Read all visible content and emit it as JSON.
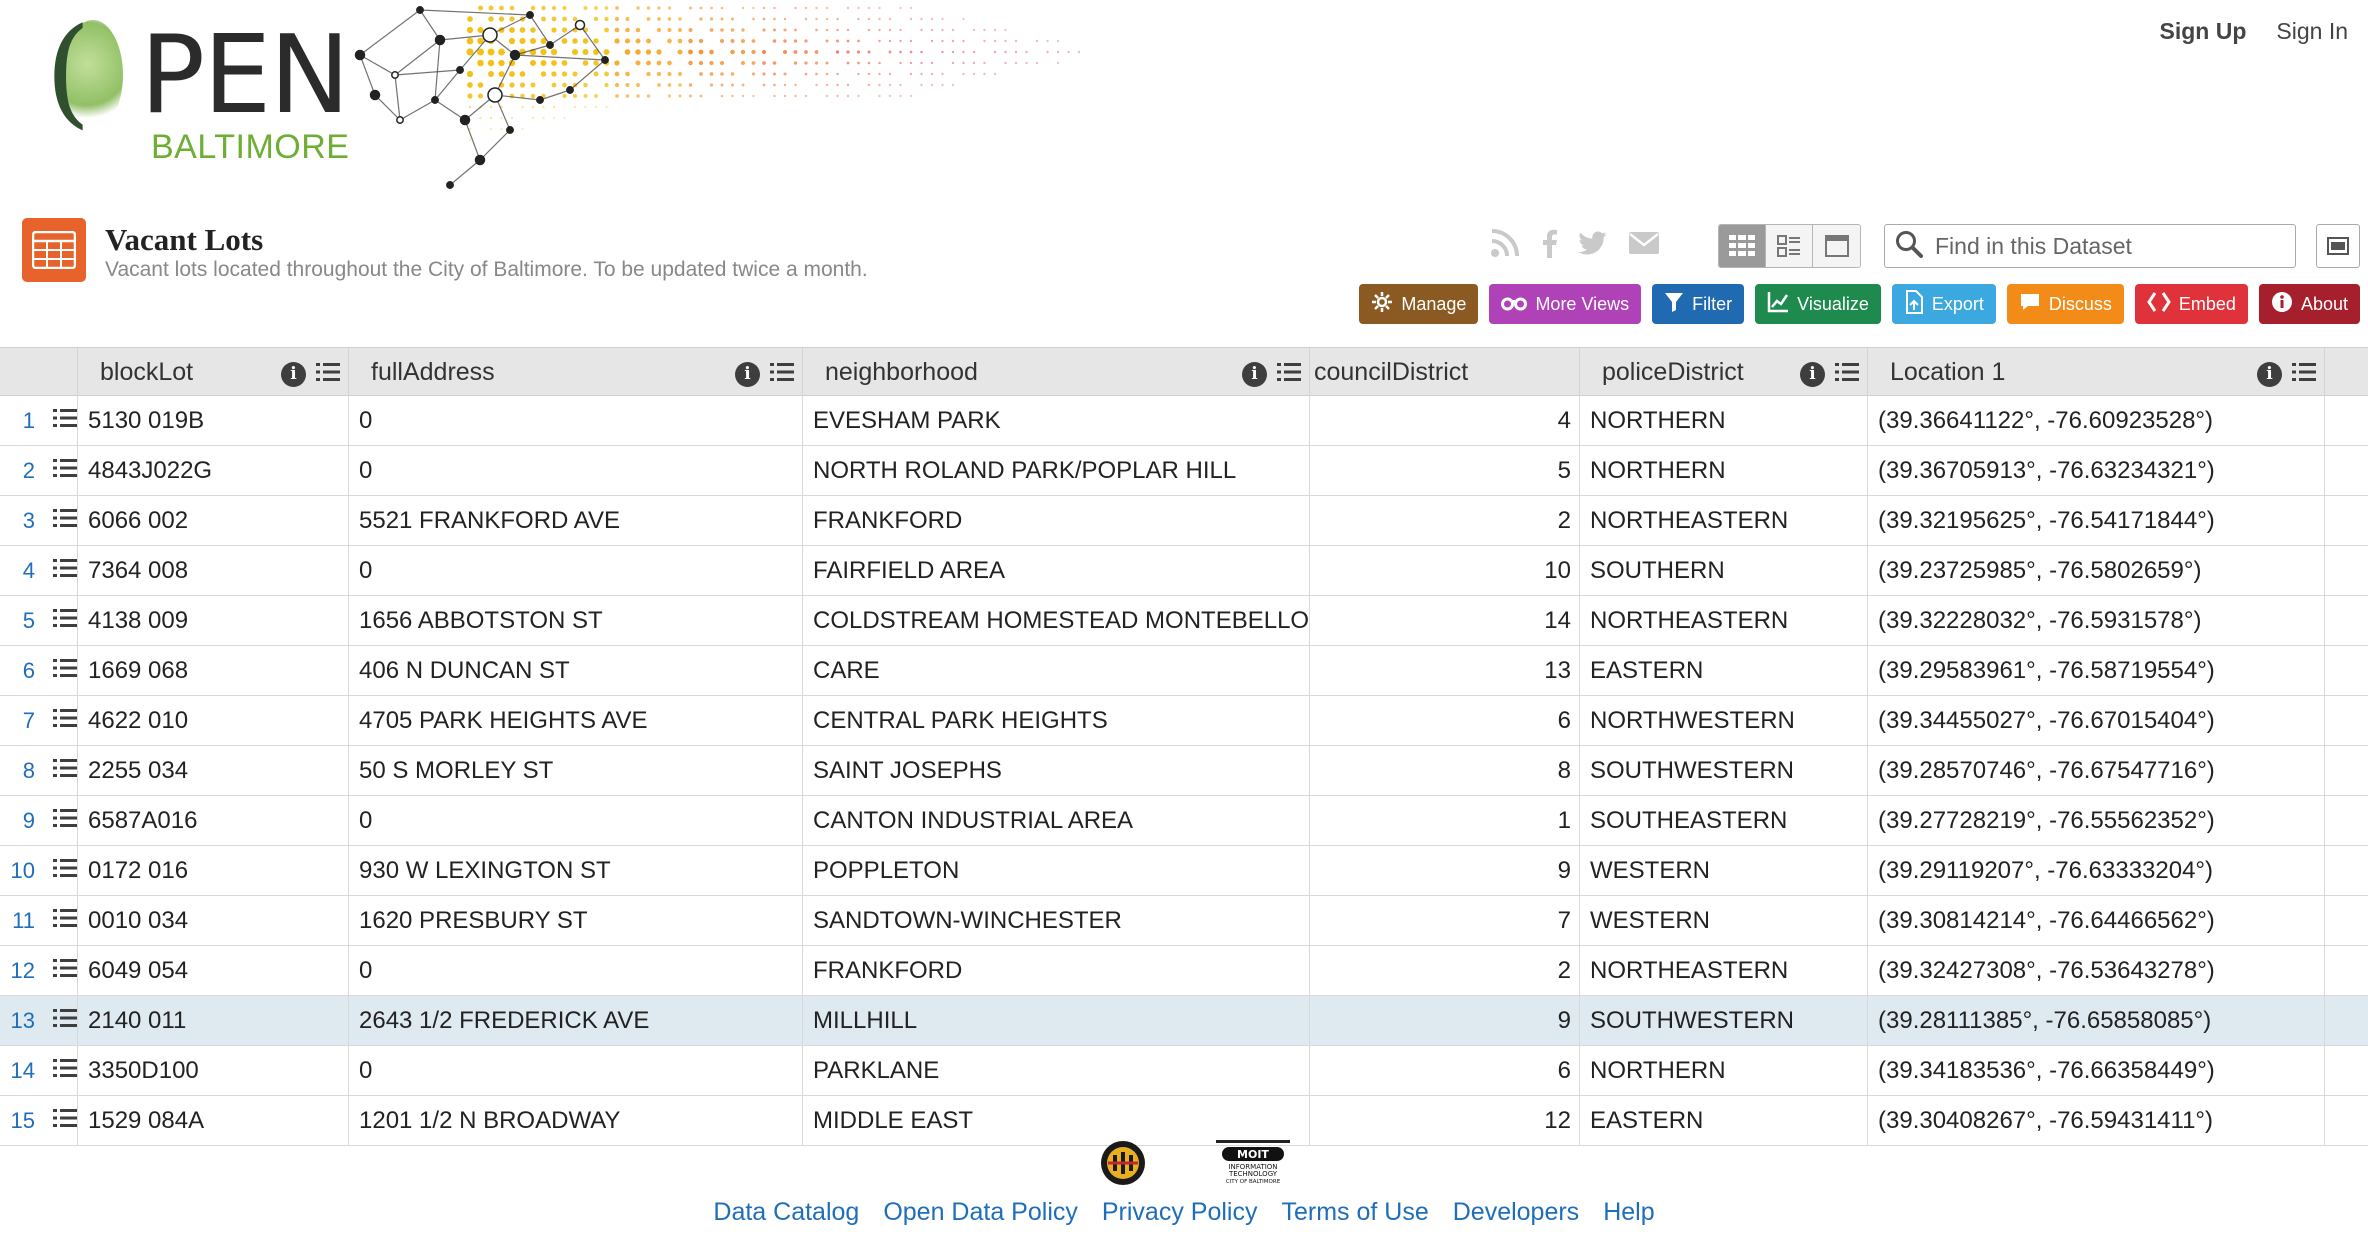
{
  "header": {
    "logo_word": "PEN",
    "logo_paren": "(",
    "logo_sub": "BALTIMORE",
    "auth": {
      "sign_up": "Sign Up",
      "sign_in": "Sign In"
    }
  },
  "dataset": {
    "title": "Vacant Lots",
    "description": "Vacant lots located throughout the City of Baltimore. To be updated twice a month."
  },
  "search": {
    "placeholder": "Find in this Dataset"
  },
  "social_icons": [
    "rss-icon",
    "facebook-icon",
    "twitter-icon",
    "email-icon"
  ],
  "actions": [
    {
      "label": "Manage",
      "color": "#8b5a22",
      "icon": "gear-icon"
    },
    {
      "label": "More Views",
      "color": "#b042b8",
      "icon": "binoculars-icon"
    },
    {
      "label": "Filter",
      "color": "#1f6ab0",
      "icon": "filter-icon"
    },
    {
      "label": "Visualize",
      "color": "#1e8a4d",
      "icon": "chart-icon"
    },
    {
      "label": "Export",
      "color": "#3ca8e0",
      "icon": "export-icon"
    },
    {
      "label": "Discuss",
      "color": "#f28b17",
      "icon": "speech-bubble-icon"
    },
    {
      "label": "Embed",
      "color": "#e0323a",
      "icon": "code-brackets-icon"
    },
    {
      "label": "About",
      "color": "#a51f2c",
      "icon": "info-icon"
    }
  ],
  "grid": {
    "columns": [
      "blockLot",
      "fullAddress",
      "neighborhood",
      "councilDistrict",
      "policeDistrict",
      "Location 1"
    ],
    "selected_row": 13,
    "rows": [
      {
        "n": "1",
        "blockLot": "5130 019B",
        "fullAddress": "0",
        "neighborhood": "EVESHAM PARK",
        "councilDistrict": "4",
        "policeDistrict": "NORTHERN",
        "location": "(39.36641122°, -76.60923528°)"
      },
      {
        "n": "2",
        "blockLot": "4843J022G",
        "fullAddress": "0",
        "neighborhood": "NORTH ROLAND PARK/POPLAR HILL",
        "councilDistrict": "5",
        "policeDistrict": "NORTHERN",
        "location": "(39.36705913°, -76.63234321°)"
      },
      {
        "n": "3",
        "blockLot": "6066 002",
        "fullAddress": "5521 FRANKFORD AVE",
        "neighborhood": "FRANKFORD",
        "councilDistrict": "2",
        "policeDistrict": "NORTHEASTERN",
        "location": "(39.32195625°, -76.54171844°)"
      },
      {
        "n": "4",
        "blockLot": "7364 008",
        "fullAddress": "0",
        "neighborhood": "FAIRFIELD AREA",
        "councilDistrict": "10",
        "policeDistrict": "SOUTHERN",
        "location": "(39.23725985°, -76.5802659°)"
      },
      {
        "n": "5",
        "blockLot": "4138 009",
        "fullAddress": "1656 ABBOTSTON ST",
        "neighborhood": "COLDSTREAM HOMESTEAD MONTEBELLO",
        "councilDistrict": "14",
        "policeDistrict": "NORTHEASTERN",
        "location": "(39.32228032°, -76.5931578°)"
      },
      {
        "n": "6",
        "blockLot": "1669 068",
        "fullAddress": "406 N DUNCAN ST",
        "neighborhood": "CARE",
        "councilDistrict": "13",
        "policeDistrict": "EASTERN",
        "location": "(39.29583961°, -76.58719554°)"
      },
      {
        "n": "7",
        "blockLot": "4622 010",
        "fullAddress": "4705 PARK HEIGHTS AVE",
        "neighborhood": "CENTRAL PARK HEIGHTS",
        "councilDistrict": "6",
        "policeDistrict": "NORTHWESTERN",
        "location": "(39.34455027°, -76.67015404°)"
      },
      {
        "n": "8",
        "blockLot": "2255 034",
        "fullAddress": "50 S MORLEY ST",
        "neighborhood": "SAINT JOSEPHS",
        "councilDistrict": "8",
        "policeDistrict": "SOUTHWESTERN",
        "location": "(39.28570746°, -76.67547716°)"
      },
      {
        "n": "9",
        "blockLot": "6587A016",
        "fullAddress": "0",
        "neighborhood": "CANTON INDUSTRIAL AREA",
        "councilDistrict": "1",
        "policeDistrict": "SOUTHEASTERN",
        "location": "(39.27728219°, -76.55562352°)"
      },
      {
        "n": "10",
        "blockLot": "0172 016",
        "fullAddress": "930 W LEXINGTON ST",
        "neighborhood": "POPPLETON",
        "councilDistrict": "9",
        "policeDistrict": "WESTERN",
        "location": "(39.29119207°, -76.63333204°)"
      },
      {
        "n": "11",
        "blockLot": "0010 034",
        "fullAddress": "1620 PRESBURY ST",
        "neighborhood": "SANDTOWN-WINCHESTER",
        "councilDistrict": "7",
        "policeDistrict": "WESTERN",
        "location": "(39.30814214°, -76.64466562°)"
      },
      {
        "n": "12",
        "blockLot": "6049 054",
        "fullAddress": "0",
        "neighborhood": "FRANKFORD",
        "councilDistrict": "2",
        "policeDistrict": "NORTHEASTERN",
        "location": "(39.32427308°, -76.53643278°)"
      },
      {
        "n": "13",
        "blockLot": "2140 011",
        "fullAddress": "2643 1/2 FREDERICK AVE",
        "neighborhood": "MILLHILL",
        "councilDistrict": "9",
        "policeDistrict": "SOUTHWESTERN",
        "location": "(39.28111385°, -76.65858085°)"
      },
      {
        "n": "14",
        "blockLot": "3350D100",
        "fullAddress": "0",
        "neighborhood": "PARKLANE",
        "councilDistrict": "6",
        "policeDistrict": "NORTHERN",
        "location": "(39.34183536°, -76.66358449°)"
      },
      {
        "n": "15",
        "blockLot": "1529 084A",
        "fullAddress": "1201 1/2 N BROADWAY",
        "neighborhood": "MIDDLE EAST",
        "councilDistrict": "12",
        "policeDistrict": "EASTERN",
        "location": "(39.30408267°, -76.59431411°)"
      }
    ]
  },
  "footer": {
    "links": [
      "Data Catalog",
      "Open Data Policy",
      "Privacy Policy",
      "Terms of Use",
      "Developers",
      "Help"
    ],
    "logos": [
      "city-seal-icon",
      "moit-logo-icon"
    ],
    "moit_text": [
      "MOIT",
      "INFORMATION",
      "TECHNOLOGY",
      "CITY OF BALTIMORE"
    ]
  }
}
